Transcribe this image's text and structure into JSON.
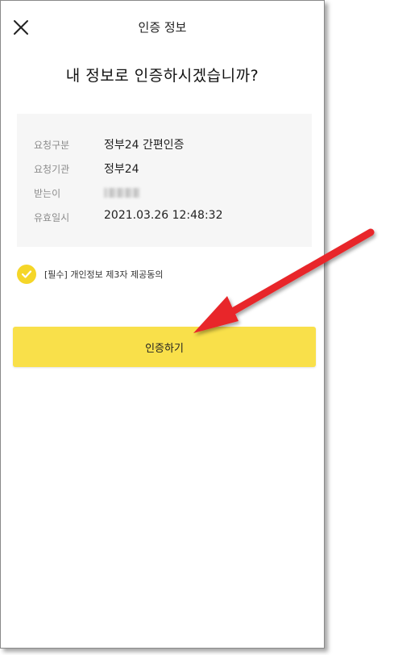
{
  "header": {
    "title": "인증 정보",
    "close_icon": "close-icon"
  },
  "main": {
    "title": "내 정보로 인증하시겠습니까?"
  },
  "info": [
    {
      "label": "요청구분",
      "value": "정부24 간편인증"
    },
    {
      "label": "요청기관",
      "value": "정부24"
    },
    {
      "label": "받는이",
      "value": ""
    },
    {
      "label": "유효일시",
      "value": "2021.03.26 12:48:32"
    }
  ],
  "consent": {
    "label": "[필수] 개인정보 제3자 제공동의",
    "checked": true,
    "icon": "check-icon"
  },
  "actions": {
    "confirm_label": "인증하기"
  },
  "colors": {
    "accent": "#f9e04a",
    "check": "#f5d628",
    "info_bg": "#f6f6f6",
    "annotation_arrow": "#e8262a"
  }
}
